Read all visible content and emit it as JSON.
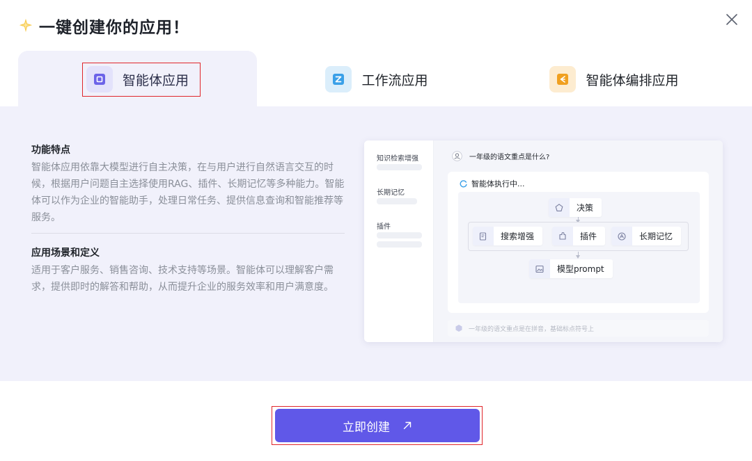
{
  "dialog": {
    "title": "一键创建你的应用！"
  },
  "tabs": [
    {
      "label": "智能体应用",
      "icon": "agent-app-icon",
      "color": "#6c63e8",
      "active": true
    },
    {
      "label": "工作流应用",
      "icon": "workflow-app-icon",
      "color": "#3aa0e8",
      "active": false
    },
    {
      "label": "智能体编排应用",
      "icon": "orchestration-app-icon",
      "color": "#f0a020",
      "active": false
    }
  ],
  "features": {
    "title": "功能特点",
    "body": "智能体应用依靠大模型进行自主决策，在与用户进行自然语言交互的时候，根据用户问题自主选择使用RAG、插件、长期记忆等多种能力。智能体可以作为企业的智能助手，处理日常任务、提供信息查询和智能推荐等服务。"
  },
  "scenarios": {
    "title": "应用场景和定义",
    "body": "适用于客户服务、销售咨询、技术支持等场景。智能体可以理解客户需求，提供即时的解答和帮助，从而提升企业的服务效率和用户满意度。"
  },
  "preview": {
    "sidebar": [
      "知识检索增强",
      "长期记忆",
      "插件"
    ],
    "question": "一年级的语文重点是什么?",
    "executing": "智能体执行中...",
    "nodes": {
      "decision": "决策",
      "search": "搜索增强",
      "plugin": "插件",
      "memory": "长期记忆",
      "model": "模型prompt"
    },
    "answer": "一年级的语文重点是在拼音，基础标点符号上"
  },
  "actions": {
    "create_label": "立即创建"
  },
  "colors": {
    "primary": "#6058e8",
    "panel_bg": "#f1f1fb",
    "highlight": "#e0252a"
  }
}
